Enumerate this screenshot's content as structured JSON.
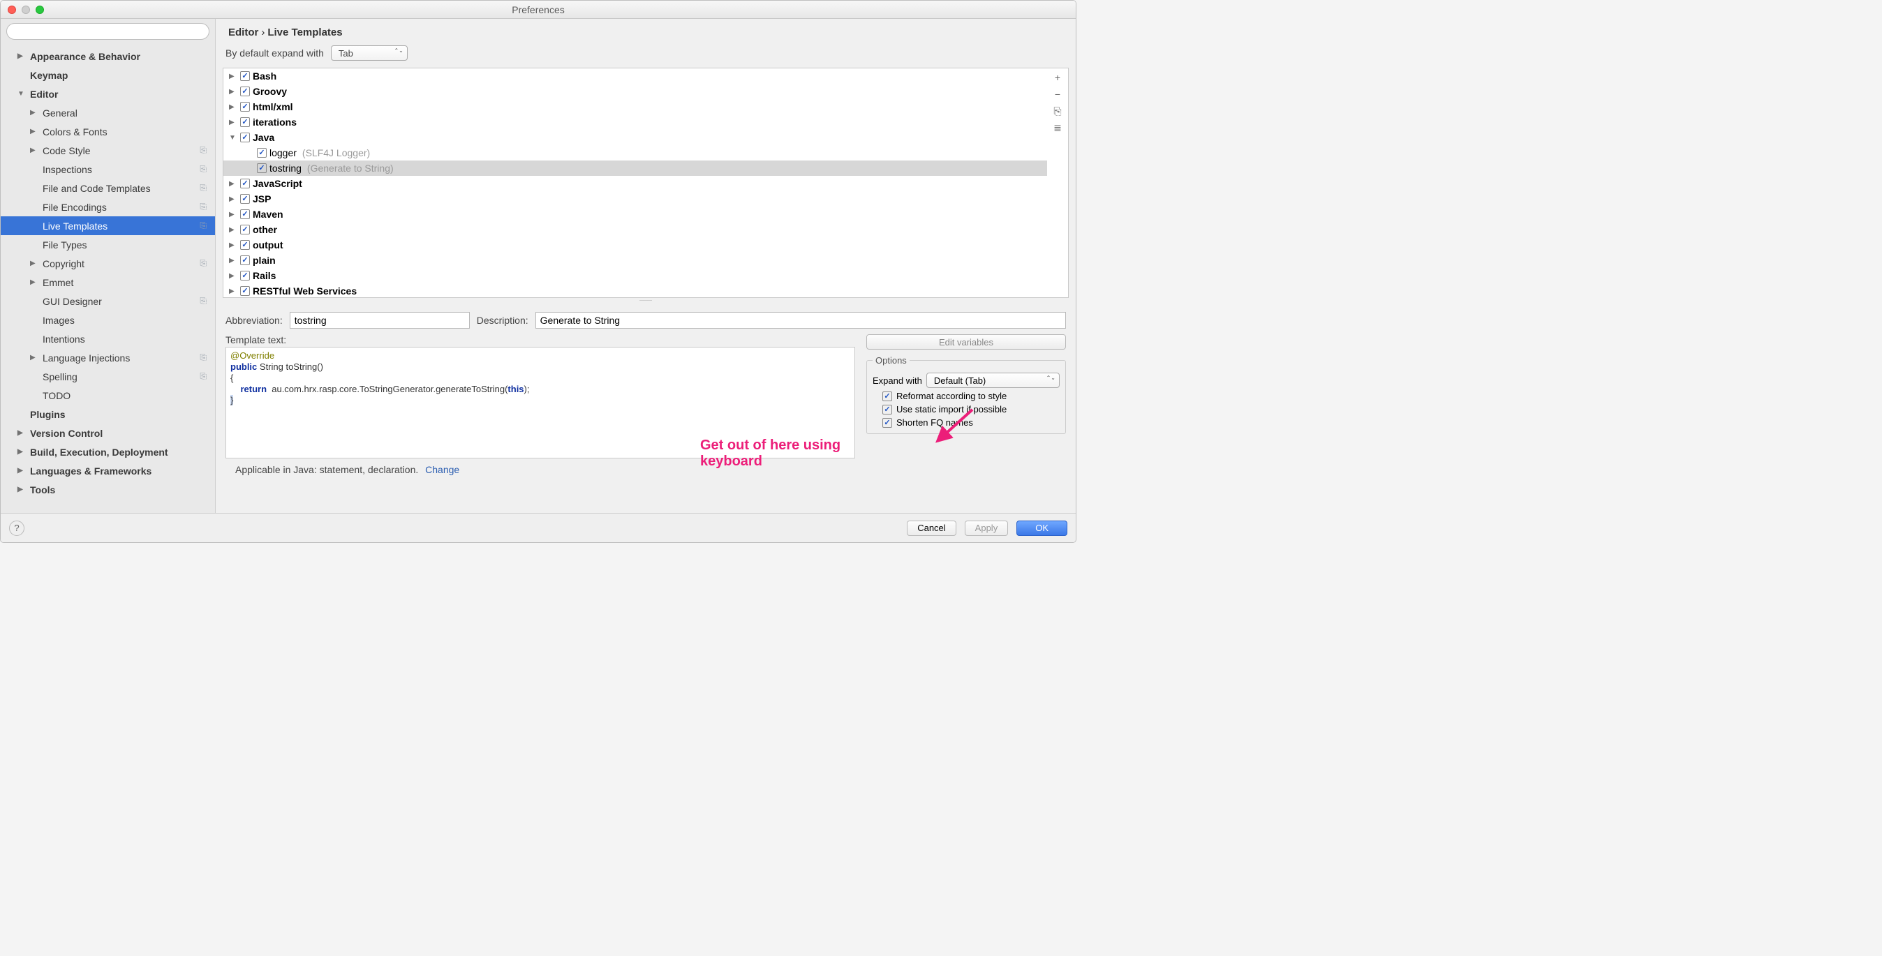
{
  "title": "Preferences",
  "search_placeholder": "",
  "sidebar": [
    {
      "label": "Appearance & Behavior",
      "arrow": "▶",
      "bold": true,
      "lv": 0
    },
    {
      "label": "Keymap",
      "arrow": "",
      "bold": true,
      "lv": 0
    },
    {
      "label": "Editor",
      "arrow": "▼",
      "bold": true,
      "lv": 0
    },
    {
      "label": "General",
      "arrow": "▶",
      "bold": false,
      "lv": 1
    },
    {
      "label": "Colors & Fonts",
      "arrow": "▶",
      "bold": false,
      "lv": 1
    },
    {
      "label": "Code Style",
      "arrow": "▶",
      "bold": false,
      "lv": 1,
      "cfg": true
    },
    {
      "label": "Inspections",
      "arrow": "",
      "bold": false,
      "lv": 1,
      "cfg": true
    },
    {
      "label": "File and Code Templates",
      "arrow": "",
      "bold": false,
      "lv": 1,
      "cfg": true
    },
    {
      "label": "File Encodings",
      "arrow": "",
      "bold": false,
      "lv": 1,
      "cfg": true
    },
    {
      "label": "Live Templates",
      "arrow": "",
      "bold": false,
      "lv": 1,
      "cfg": true,
      "selected": true
    },
    {
      "label": "File Types",
      "arrow": "",
      "bold": false,
      "lv": 1
    },
    {
      "label": "Copyright",
      "arrow": "▶",
      "bold": false,
      "lv": 1,
      "cfg": true
    },
    {
      "label": "Emmet",
      "arrow": "▶",
      "bold": false,
      "lv": 1
    },
    {
      "label": "GUI Designer",
      "arrow": "",
      "bold": false,
      "lv": 1,
      "cfg": true
    },
    {
      "label": "Images",
      "arrow": "",
      "bold": false,
      "lv": 1
    },
    {
      "label": "Intentions",
      "arrow": "",
      "bold": false,
      "lv": 1
    },
    {
      "label": "Language Injections",
      "arrow": "▶",
      "bold": false,
      "lv": 1,
      "cfg": true
    },
    {
      "label": "Spelling",
      "arrow": "",
      "bold": false,
      "lv": 1,
      "cfg": true
    },
    {
      "label": "TODO",
      "arrow": "",
      "bold": false,
      "lv": 1
    },
    {
      "label": "Plugins",
      "arrow": "",
      "bold": true,
      "lv": 0
    },
    {
      "label": "Version Control",
      "arrow": "▶",
      "bold": true,
      "lv": 0
    },
    {
      "label": "Build, Execution, Deployment",
      "arrow": "▶",
      "bold": true,
      "lv": 0
    },
    {
      "label": "Languages & Frameworks",
      "arrow": "▶",
      "bold": true,
      "lv": 0
    },
    {
      "label": "Tools",
      "arrow": "▶",
      "bold": true,
      "lv": 0
    }
  ],
  "breadcrumb": {
    "a": "Editor",
    "sep": "›",
    "b": "Live Templates"
  },
  "default_expand_label": "By default expand with",
  "default_expand_value": "Tab",
  "groups": [
    {
      "label": "Bash",
      "arrow": "▶",
      "bold": true
    },
    {
      "label": "Groovy",
      "arrow": "▶",
      "bold": true
    },
    {
      "label": "html/xml",
      "arrow": "▶",
      "bold": true
    },
    {
      "label": "iterations",
      "arrow": "▶",
      "bold": true
    },
    {
      "label": "Java",
      "arrow": "▼",
      "bold": true
    },
    {
      "label": "logger",
      "detail": "(SLF4J Logger)",
      "arrow": "",
      "child": true
    },
    {
      "label": "tostring",
      "detail": "(Generate to String)",
      "arrow": "",
      "child": true,
      "selected": true
    },
    {
      "label": "JavaScript",
      "arrow": "▶",
      "bold": true
    },
    {
      "label": "JSP",
      "arrow": "▶",
      "bold": true
    },
    {
      "label": "Maven",
      "arrow": "▶",
      "bold": true
    },
    {
      "label": "other",
      "arrow": "▶",
      "bold": true
    },
    {
      "label": "output",
      "arrow": "▶",
      "bold": true
    },
    {
      "label": "plain",
      "arrow": "▶",
      "bold": true
    },
    {
      "label": "Rails",
      "arrow": "▶",
      "bold": true
    },
    {
      "label": "RESTful Web Services",
      "arrow": "▶",
      "bold": true
    }
  ],
  "toolbar": {
    "add": "+",
    "remove": "−",
    "copy": "⎘",
    "paste": "≣"
  },
  "abbreviation_label": "Abbreviation:",
  "abbreviation_value": "tostring",
  "description_label": "Description:",
  "description_value": "Generate to String",
  "template_text_label": "Template text:",
  "template_lines": {
    "l1": "@Override",
    "l2a": "public",
    "l2b": " String toString()",
    "l3": "{",
    "l4a": "    return",
    "l4b": "  au.com.hrx.rasp.core.ToStringGenerator.generateToString(",
    "l4c": "this",
    "l4d": ");",
    "l5": "}"
  },
  "edit_vars_label": "Edit variables",
  "options_label": "Options",
  "expand_with_label": "Expand with",
  "expand_with_value": "Default (Tab)",
  "opt_reformat": "Reformat according to style",
  "opt_static": "Use static import if possible",
  "opt_shorten": "Shorten FQ names",
  "applicable_text": "Applicable in Java: statement, declaration.",
  "change_label": "Change",
  "annotation": "Get out of here using keyboard",
  "footer": {
    "cancel": "Cancel",
    "apply": "Apply",
    "ok": "OK"
  }
}
